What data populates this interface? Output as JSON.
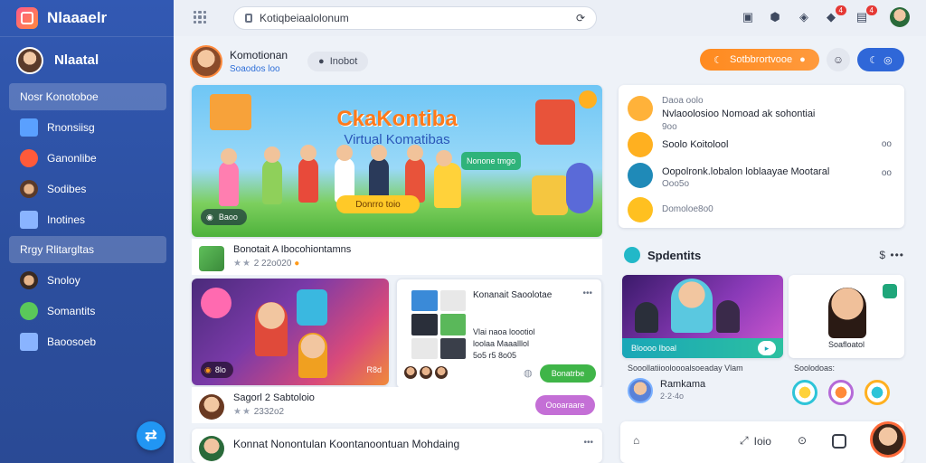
{
  "app": {
    "brand": "Nlaaaelr"
  },
  "sidebar": {
    "profile_name": "Nlaatal",
    "items": [
      {
        "label": "Nosr Konotoboe",
        "active": true,
        "icon": "home-icon",
        "color": "#2b4f9f"
      },
      {
        "label": "Rnonsiisg",
        "active": false,
        "icon": "document-icon",
        "color": "#5aa0ff"
      },
      {
        "label": "Ganonlibe",
        "active": false,
        "icon": "camera-icon",
        "color": "#ff5a3a"
      },
      {
        "label": "Sodibes",
        "active": false,
        "icon": "people-icon",
        "color": "#c98a5a"
      },
      {
        "label": "Inotines",
        "active": false,
        "icon": "briefcase-icon",
        "color": "#8ab4ff"
      },
      {
        "label": "Rrgy Rlitargltas",
        "active": true,
        "icon": "grid-icon",
        "color": "#ffffff"
      },
      {
        "label": "Snoloy",
        "active": false,
        "icon": "person-icon",
        "color": "#b07a4a"
      },
      {
        "label": "Somantits",
        "active": false,
        "icon": "smile-icon",
        "color": "#5ac85a"
      },
      {
        "label": "Baoosoeb",
        "active": false,
        "icon": "tablet-icon",
        "color": "#8ab4ff"
      }
    ]
  },
  "topbar": {
    "url": "Kotiqbeiaalolonum",
    "badge_a": "4",
    "badge_b": "4"
  },
  "header": {
    "user_name": "Komotionan",
    "user_sub": "Soaodos loo",
    "chip": "Inobot",
    "orange_button": "Sotbbrortvooe"
  },
  "hero": {
    "title": "CkaKontiba",
    "subtitle": "Virtual Komatibas",
    "pill": "Donrro toio",
    "bubble": "Nonone tmgo",
    "tag": "Baoo"
  },
  "post1": {
    "title": "Bonotait A Ibocohiontamns",
    "meta": "2 22o020"
  },
  "media1": {
    "tag": "8lo",
    "tag2": "R8d"
  },
  "media2": {
    "title": "Konanait Saoolotae",
    "sub1": "Vlai naoa loootiol",
    "sub2": "loolaa Maaalllol",
    "sub3": "5o5 r5 8o05",
    "button": "Bonatrbe"
  },
  "post2": {
    "title": "Sagorl 2 Sabtoloio",
    "meta": "2332o2",
    "button": "Oooaraare"
  },
  "post3": {
    "title": "Konnat Nonontulan Koontanoontuan Mohdaing"
  },
  "right_list": {
    "items": [
      {
        "label": "Daoa oolo",
        "sub": "Nvlaoolosioo Nomoad ak sohontiai",
        "sub2": "9oo",
        "color": "#ffb23a"
      },
      {
        "label": "Soolo Koitolool",
        "end": "oo",
        "color": "#ffb020"
      },
      {
        "label": "Oopolronk.lobalon loblaayae Mootaral",
        "sub": "Ooo5o",
        "end": "oo",
        "color": "#1f8ab8"
      },
      {
        "label": "Domoloe8o0",
        "color": "#ffc020"
      }
    ]
  },
  "section": {
    "title": "Spdentits",
    "count": "$"
  },
  "right_media": {
    "bar": "Bloooo Iboal",
    "caption2": "Soafloatol",
    "caption_left": "Sooollatiiooloooalsoeaday Vlam",
    "caption_right": "Soolodoas:",
    "host_name": "Ramkama",
    "host_sub": "2·2·4o"
  },
  "dock": {
    "item": "Ioio"
  },
  "colors": {
    "accent": "#2f67d8",
    "orange": "#ff8a1f",
    "green": "#3fb548",
    "purple": "#c46fd6"
  }
}
